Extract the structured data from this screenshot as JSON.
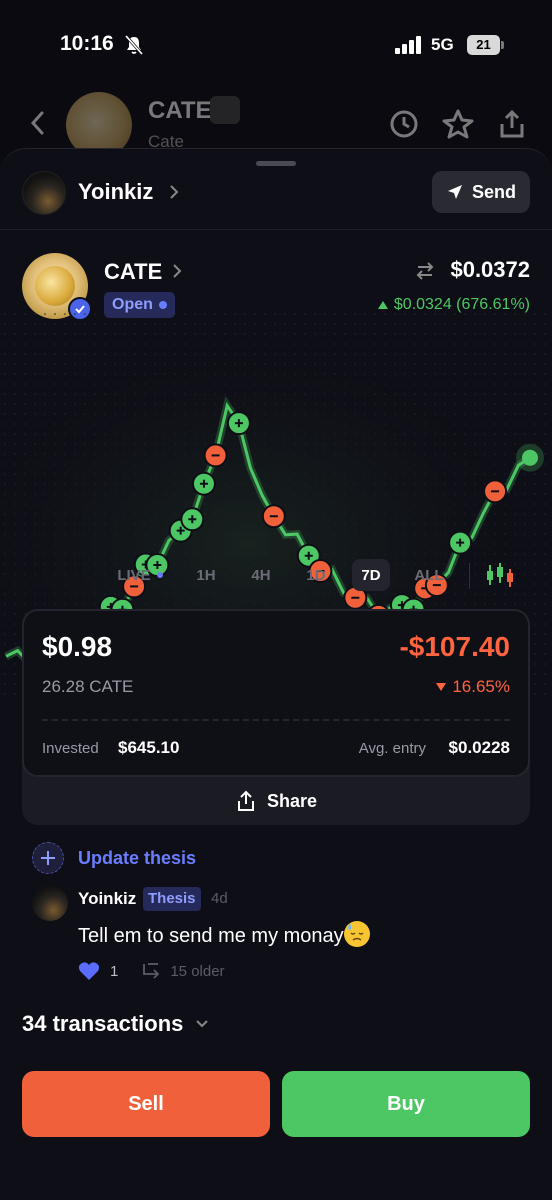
{
  "status_bar": {
    "time": "10:16",
    "network": "5G",
    "battery": "21"
  },
  "background_header": {
    "title": "CATE",
    "subtitle": "Cate"
  },
  "user": {
    "name": "Yoinkiz",
    "send_label": "Send"
  },
  "coin": {
    "name": "CATE",
    "status": "Open",
    "price": "$0.0372",
    "change": "$0.0324 (676.61%)"
  },
  "chart_data": {
    "type": "line",
    "series": [
      {
        "values": [
          0.006,
          0.006,
          0.007,
          0.008,
          0.01,
          0.012,
          0.015,
          0.02,
          0.023,
          0.027,
          0.033,
          0.046,
          0.038,
          0.028,
          0.026,
          0.022,
          0.019,
          0.016,
          0.014,
          0.013,
          0.014,
          0.016,
          0.02,
          0.025,
          0.03,
          0.034,
          0.037
        ]
      }
    ],
    "trades": [
      {
        "side": "buy",
        "index": 9
      },
      {
        "side": "buy",
        "index": 10
      },
      {
        "side": "sell",
        "index": 11
      },
      {
        "side": "buy",
        "index": 12
      },
      {
        "side": "buy",
        "index": 13
      },
      {
        "side": "buy",
        "index": 15
      },
      {
        "side": "buy",
        "index": 16
      },
      {
        "side": "buy",
        "index": 17
      },
      {
        "side": "sell",
        "index": 18
      },
      {
        "side": "buy",
        "index": 20
      },
      {
        "side": "sell",
        "index": 23
      },
      {
        "side": "buy",
        "index": 26
      },
      {
        "side": "sell",
        "index": 27
      },
      {
        "side": "sell",
        "index": 30
      },
      {
        "side": "sell",
        "index": 32
      },
      {
        "side": "buy",
        "index": 34
      },
      {
        "side": "buy",
        "index": 35
      },
      {
        "side": "sell",
        "index": 36
      },
      {
        "side": "sell",
        "index": 37
      },
      {
        "side": "buy",
        "index": 39
      },
      {
        "side": "sell",
        "index": 42
      }
    ],
    "colors": {
      "line": "#4cc764",
      "buy": "#4cc764",
      "sell": "#f0603a"
    }
  },
  "ranges": {
    "live": "LIVE",
    "h1": "1H",
    "h4": "4H",
    "d1": "1D",
    "d7": "7D",
    "all": "ALL",
    "active": "7D"
  },
  "position": {
    "value": "$0.98",
    "pnl": "-$107.40",
    "amount": "26.28 CATE",
    "pnl_pct": "16.65%",
    "invested_label": "Invested",
    "invested": "$645.10",
    "entry_label": "Avg. entry",
    "entry": "$0.0228",
    "share_label": "Share"
  },
  "thesis": {
    "update_label": "Update thesis",
    "author": "Yoinkiz",
    "badge": "Thesis",
    "time": "4d",
    "text": "Tell em to send me my monay",
    "likes": "1",
    "older": "15 older"
  },
  "transactions": {
    "label": "34 transactions"
  },
  "actions": {
    "sell": "Sell",
    "buy": "Buy"
  },
  "colors": {
    "accent": "#6b7dff",
    "positive": "#4cc764",
    "negative": "#ff6340",
    "background": "#0a0a10"
  }
}
